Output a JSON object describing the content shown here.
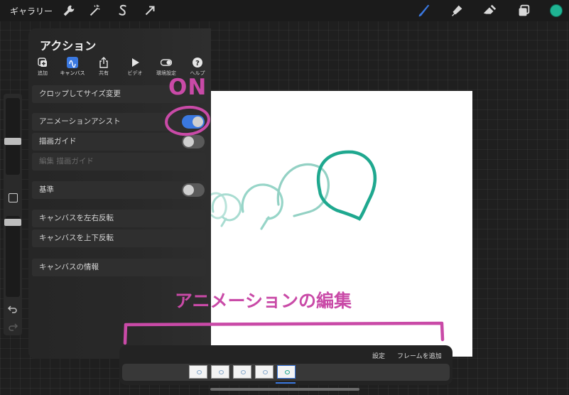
{
  "topbar": {
    "gallery_label": "ギャラリー",
    "tools": [
      "wrench-icon",
      "magic-wand-icon",
      "selection-icon",
      "transform-arrow-icon"
    ],
    "right_tools": [
      "brush-icon",
      "smudge-icon",
      "eraser-icon",
      "layers-icon"
    ],
    "current_color": "#1fb493"
  },
  "actions_panel": {
    "title": "アクション",
    "tabs": [
      {
        "label": "追加",
        "icon": "add-icon"
      },
      {
        "label": "キャンバス",
        "icon": "canvas-icon",
        "active": true
      },
      {
        "label": "共有",
        "icon": "share-icon"
      },
      {
        "label": "ビデオ",
        "icon": "play-icon"
      },
      {
        "label": "環境設定",
        "icon": "toggle-icon"
      },
      {
        "label": "ヘルプ",
        "icon": "help-icon"
      }
    ],
    "rows": {
      "crop": "クロップしてサイズ変更",
      "animation_assist": "アニメーションアシスト",
      "animation_assist_on": true,
      "drawing_guide": "描画ガイド",
      "drawing_guide_on": false,
      "edit_drawing_guide": "編集 描画ガイド",
      "reference": "基準",
      "reference_on": false,
      "flip_horizontal": "キャンバスを左右反転",
      "flip_vertical": "キャンバスを上下反転",
      "canvas_info": "キャンバスの情報"
    }
  },
  "timeline": {
    "settings_label": "設定",
    "add_frame_label": "フレームを追加",
    "frame_count": 5,
    "selected_frame": 5
  },
  "annotations": {
    "on_label": "ON",
    "edit_label": "アニメーションの編集",
    "color": "#c94aa7"
  },
  "artwork": {
    "stroke_color": "#1fa88f"
  }
}
